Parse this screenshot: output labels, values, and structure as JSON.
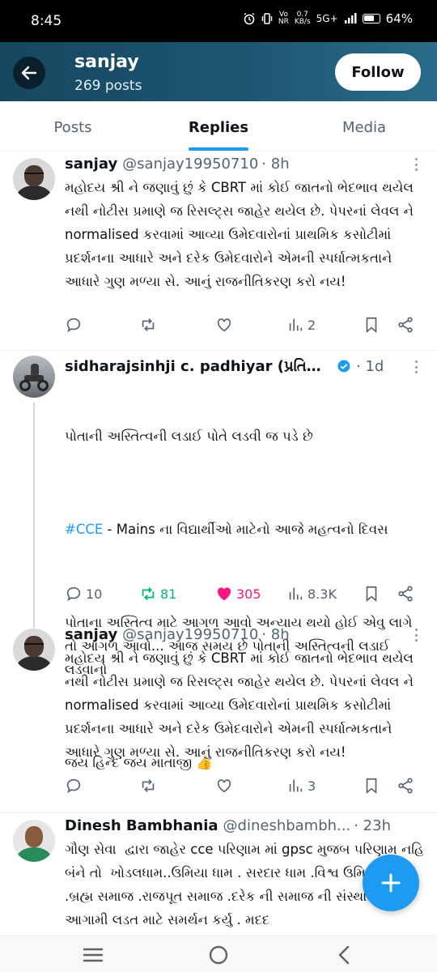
{
  "status_bar": {
    "time": "8:45",
    "net_speed_value": "0.7",
    "net_speed_unit": "KB/s",
    "network": "5G+",
    "vo_label": "Vo",
    "nr_label": "NR",
    "battery": "64%"
  },
  "header": {
    "name": "sanjay",
    "posts": "269 posts",
    "follow_label": "Follow"
  },
  "tabs": [
    {
      "label": "Posts",
      "active": false
    },
    {
      "label": "Replies",
      "active": true
    },
    {
      "label": "Media",
      "active": false
    }
  ],
  "tweets": [
    {
      "name": "sanjay",
      "handle": "@sanjay19950710",
      "time": "· 8h",
      "body": "મહોદય શ્રી ને જણાવું છું કે CBRT માં કોઈ જાતનો ભેદભાવ થયેલ નથી નોટીસ પ્રમાણે જ રિસલ્ટ્સ જાહેર થયેલ છે. પેપરનાં લેવલ ને normalised કરવામાં આવ્યા ઉમેદવારોનાં પ્રાથમિક કસોટીમાં પ્રદર્શનના આધારે અને દરેક ઉમેદવારોને એમની સ્પર્ધાત્મકતાને આધારે ગુણ મળ્યા સે. આનું રાજનીતિકરણ કરો નય!",
      "replies": "",
      "reposts": "",
      "likes": "",
      "views": "2"
    },
    {
      "name": "sidharajsinhji c. padhiyar (પ્રતિહાર)...",
      "handle": "",
      "time": "· 1d",
      "body_line1": "પોતાની અસ્તિત્વની લડાઈ પોતે લડવી જ પડે છે",
      "hashtag": "#CCE",
      "body_line2": " - Mains ના વિદ્યાર્થીઓ માટેનો આજે મહત્વનો દિવસ",
      "body_line3": "પોતાના અસ્તિત્વ માટે આગળ આવો અન્યાય થયો હોઈ એવુ લાગે તો આગળ આવો... આજ સમય છે પોતાની અસ્તિત્વની લડાઈ લડવાનો",
      "body_line4": "જય હિન્દ જય માતાજી 👍",
      "replies": "10",
      "reposts": "81",
      "likes": "305",
      "views": "8.3K"
    },
    {
      "name": "sanjay",
      "handle": "@sanjay19950710",
      "time": "· 8h",
      "body": "મહોદય શ્રી ને જણાવું છું કે CBRT માં કોઈ જાતનો ભેદભાવ થયેલ નથી નોટીસ પ્રમાણે જ રિસલ્ટ્સ જાહેર થયેલ છે. પેપરનાં લેવલ ને normalised કરવામાં આવ્યા ઉમેદવારોનાં પ્રાથમિક કસોટીમાં પ્રદર્શનના આધારે અને દરેક ઉમેદવારોને એમની સ્પર્ધાત્મકતાને આધારે ગુણ મળ્યા સે. આનું રાજનીતિકરણ કરો નય!",
      "replies": "",
      "reposts": "",
      "likes": "",
      "views": "3"
    },
    {
      "name": "Dinesh Bambhania",
      "handle": "@dineshbambh...",
      "time": "· 23h",
      "body": "ગૌણ સેવા  દ્વારા જાહેર cce પરિણામ માં gpsc મુજબ પરિણામ નહિ બંને તો  ખોડલધામ..ઉમિયા ધામ . સરદાર ધામ .વિશ્વ ઉમિયા ધામ .બ્રહ્મ સમાજ .રાજપૂત સમાજ .દરેક ની સમાજ ની સંસ્થા એ આગામી લડત માટે સમર્થન કર્યુ . મદદ"
    }
  ],
  "colors": {
    "accent": "#1d9bf0",
    "repost_active": "#00ba7c",
    "like_active": "#f91880",
    "header_bg": "#1d5571"
  },
  "icons": [
    "back-arrow-icon",
    "more-icon",
    "reply-icon",
    "repost-icon",
    "like-icon",
    "views-icon",
    "bookmark-icon",
    "share-icon",
    "verified-icon",
    "plus-icon",
    "recents-icon",
    "home-icon",
    "back-icon"
  ]
}
